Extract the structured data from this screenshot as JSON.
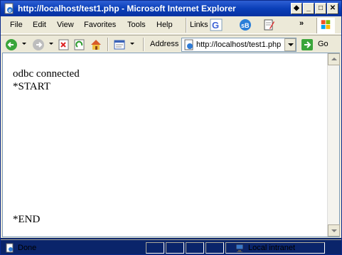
{
  "window": {
    "title": "http://localhost/test1.php - Microsoft Internet Explorer",
    "buttons": [
      "min",
      "max",
      "close"
    ]
  },
  "menubar": {
    "items": [
      {
        "label": "File"
      },
      {
        "label": "Edit"
      },
      {
        "label": "View"
      },
      {
        "label": "Favorites"
      },
      {
        "label": "Tools"
      },
      {
        "label": "Help"
      }
    ],
    "links_label": "Links",
    "chevron": "»"
  },
  "toolbar": {
    "address_label": "Address",
    "address_value": "http://localhost/test1.php",
    "go_label": "Go"
  },
  "content": {
    "lines": [
      "odbc connected",
      "*START"
    ],
    "end_text": "*END"
  },
  "status": {
    "text": "Done",
    "zone": "Local intranet"
  }
}
